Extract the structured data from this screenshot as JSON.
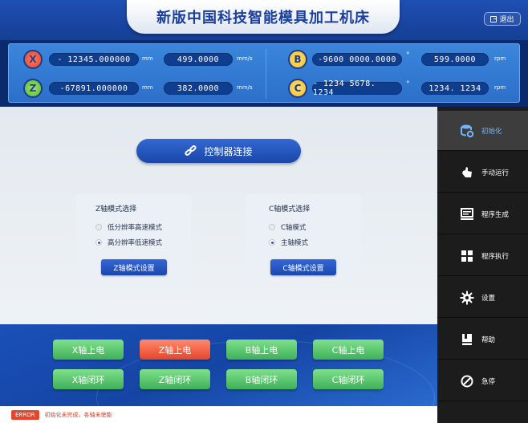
{
  "header": {
    "title": "新版中国科技智能模具加工机床",
    "exit_label": "退出"
  },
  "axes": [
    {
      "name": "X",
      "position": "- 12345.000000",
      "pos_unit": "mm",
      "speed": "499.0000",
      "speed_unit": "mm/s"
    },
    {
      "name": "Z",
      "position": "-67891.000000",
      "pos_unit": "mm",
      "speed": "382.0000",
      "speed_unit": "mm/s"
    },
    {
      "name": "B",
      "position": "-9600 0000.0000",
      "pos_unit": "°",
      "speed": "599.0000",
      "speed_unit": "rpm"
    },
    {
      "name": "C",
      "position": "- 1234 5678. 1234",
      "pos_unit": "°",
      "speed": "1234. 1234",
      "speed_unit": "rpm"
    }
  ],
  "main": {
    "connect_label": "控制器连接"
  },
  "z_mode": {
    "title": "Z轴模式选择",
    "options": [
      "低分辨率高速模式",
      "高分辨率低速模式"
    ],
    "selected": 1,
    "button": "Z轴模式设置"
  },
  "c_mode": {
    "title": "C轴模式选择",
    "options": [
      "C轴模式",
      "主轴模式"
    ],
    "selected": 1,
    "button": "C轴模式设置"
  },
  "power": {
    "row1": [
      {
        "label": "X轴上电",
        "color": "green"
      },
      {
        "label": "Z轴上电",
        "color": "red"
      },
      {
        "label": "B轴上电",
        "color": "green"
      },
      {
        "label": "C轴上电",
        "color": "green"
      }
    ],
    "row2": [
      {
        "label": "X轴闭环",
        "color": "green"
      },
      {
        "label": "Z轴闭环",
        "color": "green"
      },
      {
        "label": "B轴闭环",
        "color": "green"
      },
      {
        "label": "C轴闭环",
        "color": "green"
      }
    ]
  },
  "status": {
    "badge": "ERROR",
    "message": "初始化未完成，各轴未使能"
  },
  "sidebar": {
    "items": [
      {
        "label": "初始化",
        "icon": "database-gear-icon",
        "active": true
      },
      {
        "label": "手动运行",
        "icon": "hand-icon"
      },
      {
        "label": "程序生成",
        "icon": "monitor-icon"
      },
      {
        "label": "程序执行",
        "icon": "grid-icon"
      },
      {
        "label": "设置",
        "icon": "gear-icon"
      },
      {
        "label": "帮助",
        "icon": "book-icon"
      },
      {
        "label": "急停",
        "icon": "stop-icon"
      }
    ]
  },
  "colors": {
    "accent": "#1a47a8",
    "green": "#3fb05a",
    "red": "#e5452c",
    "active_text": "#6fb6ff"
  }
}
